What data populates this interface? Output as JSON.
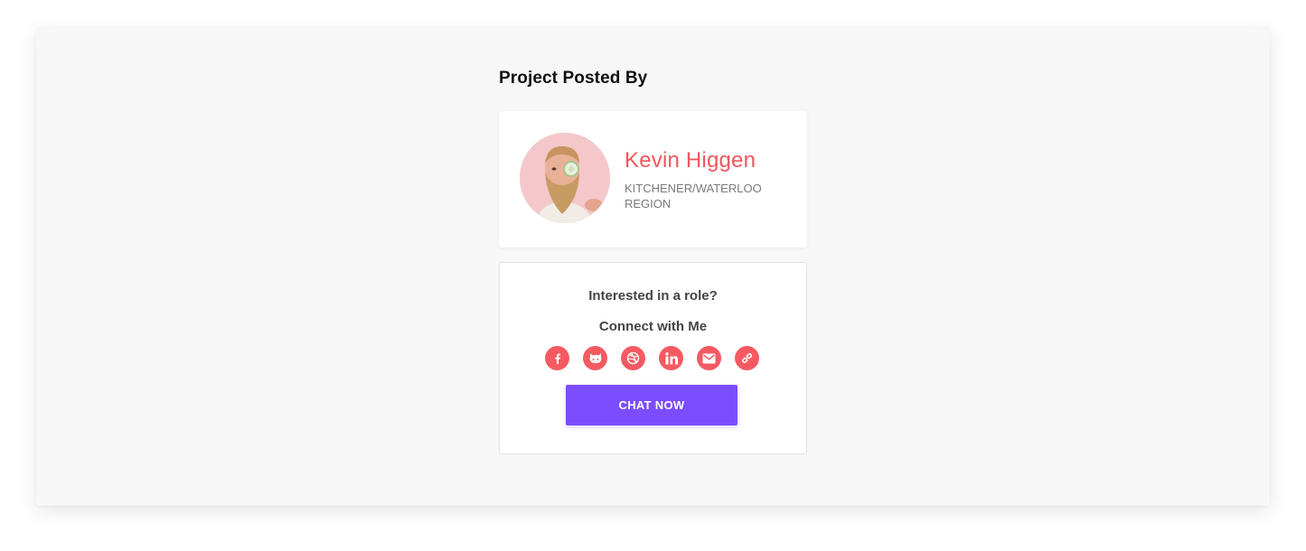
{
  "section": {
    "title": "Project Posted By"
  },
  "poster": {
    "name": "Kevin Higgen",
    "location": "KITCHENER/WATERLOO REGION",
    "avatar_icon": "person-avatar"
  },
  "connect": {
    "question": "Interested in a role?",
    "prompt": "Connect with Me",
    "social": [
      {
        "name": "facebook",
        "icon": "facebook-icon"
      },
      {
        "name": "github",
        "icon": "github-icon"
      },
      {
        "name": "dribbble",
        "icon": "dribbble-icon"
      },
      {
        "name": "linkedin",
        "icon": "linkedin-icon"
      },
      {
        "name": "email",
        "icon": "email-icon"
      },
      {
        "name": "link",
        "icon": "link-icon"
      }
    ],
    "chat_button": "CHAT NOW"
  },
  "colors": {
    "accent_red": "#f0575f",
    "chat_purple": "#7c4dff",
    "panel_bg": "#f7f7f7"
  }
}
